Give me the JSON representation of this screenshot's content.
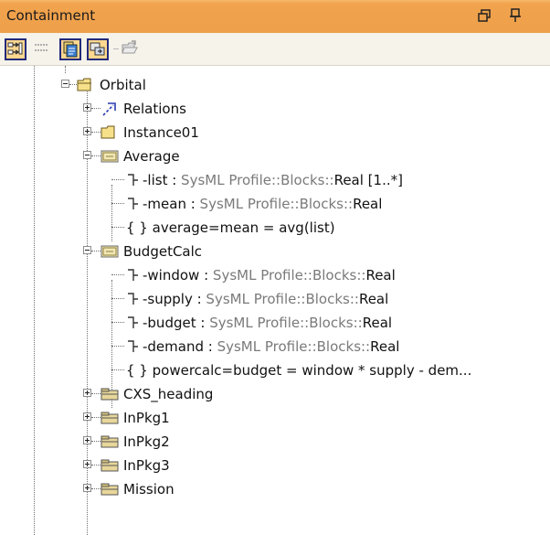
{
  "panel": {
    "title": "Containment",
    "restore_glyph": "⎗",
    "pin_glyph": "↕"
  },
  "toolbar": {
    "buttons": [
      {
        "name": "show-tree-icon",
        "pressed": true
      },
      {
        "name": "link-views-icon",
        "pressed": false
      },
      {
        "name": "model-browser-icon",
        "pressed": true
      },
      {
        "name": "filter-icon",
        "pressed": true
      },
      {
        "name": "open-folder-icon",
        "pressed": false
      }
    ]
  },
  "tree": {
    "rows": [
      {
        "label": "Orbital",
        "icon": "folder-open-icon",
        "expander": "minus"
      },
      {
        "label": "Relations",
        "icon": "relations-icon",
        "expander": "plus"
      },
      {
        "label": "Instance01",
        "icon": "folder-icon",
        "expander": "plus"
      },
      {
        "label": "Average",
        "icon": "constraint-block-icon",
        "expander": "minus"
      },
      {
        "name_part": "-list : ",
        "type_part": "SysML Profile::Blocks::",
        "tail_part": "Real [1..*]",
        "icon": "property-icon"
      },
      {
        "name_part": "-mean : ",
        "type_part": "SysML Profile::Blocks::",
        "tail_part": "Real",
        "icon": "property-icon"
      },
      {
        "label": "{ }  average=mean = avg(list)",
        "icon": "none"
      },
      {
        "label": "BudgetCalc",
        "icon": "constraint-block-icon",
        "expander": "minus"
      },
      {
        "name_part": "-window : ",
        "type_part": "SysML Profile::Blocks::",
        "tail_part": "Real",
        "icon": "property-icon"
      },
      {
        "name_part": "-supply : ",
        "type_part": "SysML Profile::Blocks::",
        "tail_part": "Real",
        "icon": "property-icon"
      },
      {
        "name_part": "-budget : ",
        "type_part": "SysML Profile::Blocks::",
        "tail_part": "Real",
        "icon": "property-icon"
      },
      {
        "name_part": "-demand : ",
        "type_part": "SysML Profile::Blocks::",
        "tail_part": "Real",
        "icon": "property-icon"
      },
      {
        "label": "{ }  powercalc=budget = window * supply - dem...",
        "icon": "none"
      },
      {
        "label": "CXS_heading",
        "icon": "package-icon",
        "expander": "plus"
      },
      {
        "label": "InPkg1",
        "icon": "package-icon",
        "expander": "plus"
      },
      {
        "label": "InPkg2",
        "icon": "package-icon",
        "expander": "plus"
      },
      {
        "label": "InPkg3",
        "icon": "package-icon",
        "expander": "plus"
      },
      {
        "label": "Mission",
        "icon": "package-icon",
        "expander": "plus"
      }
    ]
  },
  "colors": {
    "title_bar": "#eea04b",
    "toolbar": "#f5f3ea",
    "pressed_button": "#ffd88f",
    "type_text": "#7a7a7a"
  }
}
